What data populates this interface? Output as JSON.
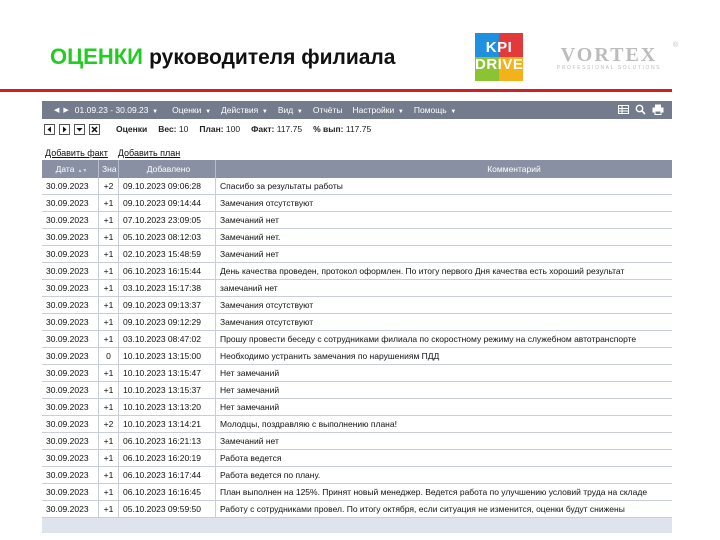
{
  "slide": {
    "title_accent": "ОЦЕНКИ",
    "title_rest": "руководителя филиала",
    "kpi_logo_line1": "KPI",
    "kpi_logo_line2": "DRIVE",
    "vortex_name": "VORTEX",
    "vortex_sub": "PROFESSIONAL SOLUTIONS",
    "vortex_reg": "®",
    "colors": {
      "accent": "#22cc22",
      "rule": "#d02020",
      "toolbar": "#737b8c",
      "header": "#8a90a4"
    }
  },
  "toolbar": {
    "period": "01.09.23 - 30.09.23",
    "menus": [
      "Оценки",
      "Действия",
      "Вид",
      "Отчёты",
      "Настройки",
      "Помощь"
    ],
    "menus_with_caret": [
      true,
      true,
      true,
      false,
      true,
      true
    ],
    "tools": [
      "grid-icon",
      "search-icon",
      "print-icon"
    ]
  },
  "infobar": {
    "section": "Оценки",
    "weight_label": "Вес:",
    "weight": "10",
    "plan_label": "План:",
    "plan": "100",
    "fact_label": "Факт:",
    "fact": "117.75",
    "pct_label": "% вып:",
    "pct": "117.75"
  },
  "actions": {
    "add_fact": "Добавить факт",
    "add_plan": "Добавить план"
  },
  "table": {
    "columns": [
      "Дата",
      "Зна",
      "Добавлено",
      "Комментарий"
    ],
    "rows": [
      [
        "30.09.2023",
        "+2",
        "09.10.2023 09:06:28",
        "Спасибо за результаты работы"
      ],
      [
        "30.09.2023",
        "+1",
        "09.10.2023 09:14:44",
        "Замечания отсутствуют"
      ],
      [
        "30.09.2023",
        "+1",
        "07.10.2023 23:09:05",
        "Замечаний нет"
      ],
      [
        "30.09.2023",
        "+1",
        "05.10.2023 08:12:03",
        "Замечаний нет."
      ],
      [
        "30.09.2023",
        "+1",
        "02.10.2023 15:48:59",
        "Замечаний нет"
      ],
      [
        "30.09.2023",
        "+1",
        "06.10.2023 16:15:44",
        "День качества проведен, протокол оформлен. По итогу первого Дня качества есть хороший результат"
      ],
      [
        "30.09.2023",
        "+1",
        "03.10.2023 15:17:38",
        "замечаний нет"
      ],
      [
        "30.09.2023",
        "+1",
        "09.10.2023 09:13:37",
        "Замечания отсутствуют"
      ],
      [
        "30.09.2023",
        "+1",
        "09.10.2023 09:12:29",
        "Замечания отсутствуют"
      ],
      [
        "30.09.2023",
        "+1",
        "03.10.2023 08:47:02",
        "Прошу провести беседу с сотрудниками филиала по скоростному режиму на служебном автотранспорте"
      ],
      [
        "30.09.2023",
        "0",
        "10.10.2023 13:15:00",
        "Необходимо устранить замечания по нарушениям ПДД"
      ],
      [
        "30.09.2023",
        "+1",
        "10.10.2023 13:15:47",
        "Нет замечаний"
      ],
      [
        "30.09.2023",
        "+1",
        "10.10.2023 13:15:37",
        "Нет замечаний"
      ],
      [
        "30.09.2023",
        "+1",
        "10.10.2023 13:13:20",
        "Нет замечаний"
      ],
      [
        "30.09.2023",
        "+2",
        "10.10.2023 13:14:21",
        "Молодцы, поздравляю с выполнению плана!"
      ],
      [
        "30.09.2023",
        "+1",
        "06.10.2023 16:21:13",
        "Замечаний нет"
      ],
      [
        "30.09.2023",
        "+1",
        "06.10.2023 16:20:19",
        "Работа ведется"
      ],
      [
        "30.09.2023",
        "+1",
        "06.10.2023 16:17:44",
        "Работа ведется по плану."
      ],
      [
        "30.09.2023",
        "+1",
        "06.10.2023 16:16:45",
        "План выполнен на 125%. Принят новый менеджер. Ведется работа по улучшению условий труда на складе"
      ],
      [
        "30.09.2023",
        "+1",
        "05.10.2023 09:59:50",
        "Работу с сотрудниками провел. По итогу октября, если ситуация не изменится, оценки будут снижены"
      ]
    ]
  }
}
